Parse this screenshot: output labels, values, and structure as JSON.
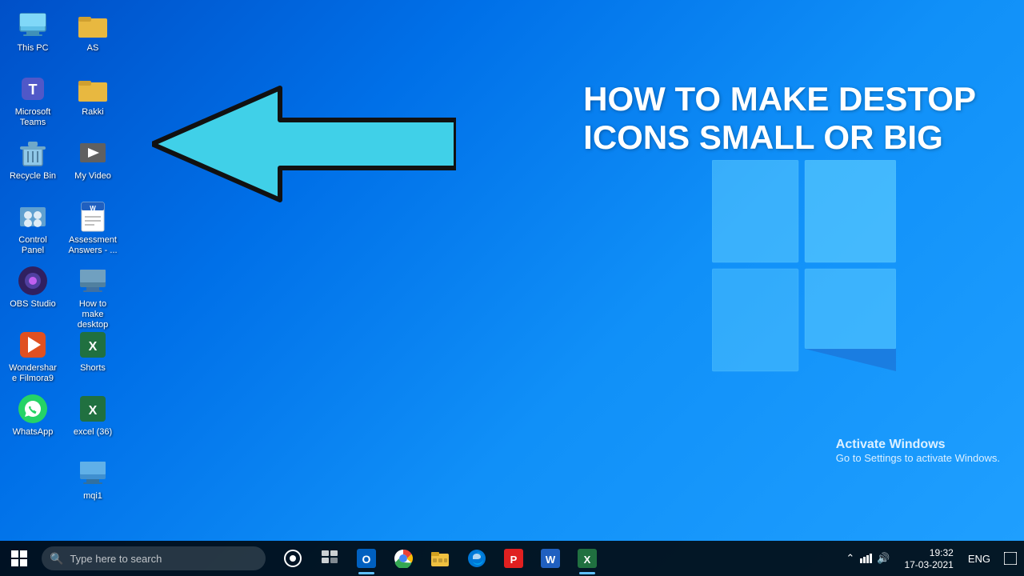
{
  "desktop": {
    "background": "blue gradient",
    "tutorial": {
      "line1": "HOW TO MAKE DESTOP",
      "line2": "ICONS SMALL OR BIG"
    },
    "activate_windows": {
      "title": "Activate Windows",
      "subtitle": "Go to Settings to activate Windows."
    }
  },
  "icons": {
    "col1": [
      {
        "id": "this-pc",
        "label": "This PC",
        "emoji": "💻"
      },
      {
        "id": "microsoft-teams",
        "label": "Microsoft Teams",
        "emoji": "👥"
      },
      {
        "id": "recycle-bin",
        "label": "Recycle Bin",
        "emoji": "🗑"
      },
      {
        "id": "control-panel",
        "label": "Control Panel",
        "emoji": "🖥"
      },
      {
        "id": "obs-studio",
        "label": "OBS Studio",
        "emoji": "⏺"
      },
      {
        "id": "wondershare-filmora9",
        "label": "Wondershare Filmora9",
        "emoji": "🎬"
      },
      {
        "id": "whatsapp",
        "label": "WhatsApp",
        "emoji": "💬"
      }
    ],
    "col2": [
      {
        "id": "as-folder",
        "label": "AS",
        "emoji": "📁"
      },
      {
        "id": "rakki-folder",
        "label": "Rakki",
        "emoji": "📁"
      },
      {
        "id": "my-video",
        "label": "My Video",
        "emoji": "🖥"
      },
      {
        "id": "assessment-answers",
        "label": "Assessment Answers - ...",
        "emoji": "📄"
      },
      {
        "id": "how-to-make",
        "label": "How to make desktop ico...",
        "emoji": "🖥"
      },
      {
        "id": "shorts",
        "label": "Shorts",
        "emoji": "📊"
      },
      {
        "id": "excel-36",
        "label": "excel (36)",
        "emoji": "📊"
      },
      {
        "id": "mqi1",
        "label": "mqi1",
        "emoji": "🖥"
      }
    ]
  },
  "taskbar": {
    "search_placeholder": "Type here to search",
    "time": "19:32",
    "date": "17-03-2021",
    "lang": "ENG",
    "icons": [
      {
        "id": "cortana",
        "label": "Search",
        "symbol": "⬤"
      },
      {
        "id": "task-view",
        "label": "Task View",
        "symbol": "☰"
      },
      {
        "id": "outlook",
        "label": "Outlook",
        "symbol": "O"
      },
      {
        "id": "chrome",
        "label": "Google Chrome",
        "symbol": "⊕"
      },
      {
        "id": "file-explorer",
        "label": "File Explorer",
        "symbol": "📁"
      },
      {
        "id": "edge",
        "label": "Microsoft Edge",
        "symbol": "e"
      },
      {
        "id": "pdf",
        "label": "PDF Tool",
        "symbol": "P"
      },
      {
        "id": "word",
        "label": "Word",
        "symbol": "W"
      },
      {
        "id": "excel",
        "label": "Excel",
        "symbol": "X"
      }
    ],
    "tray": {
      "icons": [
        "^",
        "📶",
        "🔊"
      ]
    }
  }
}
